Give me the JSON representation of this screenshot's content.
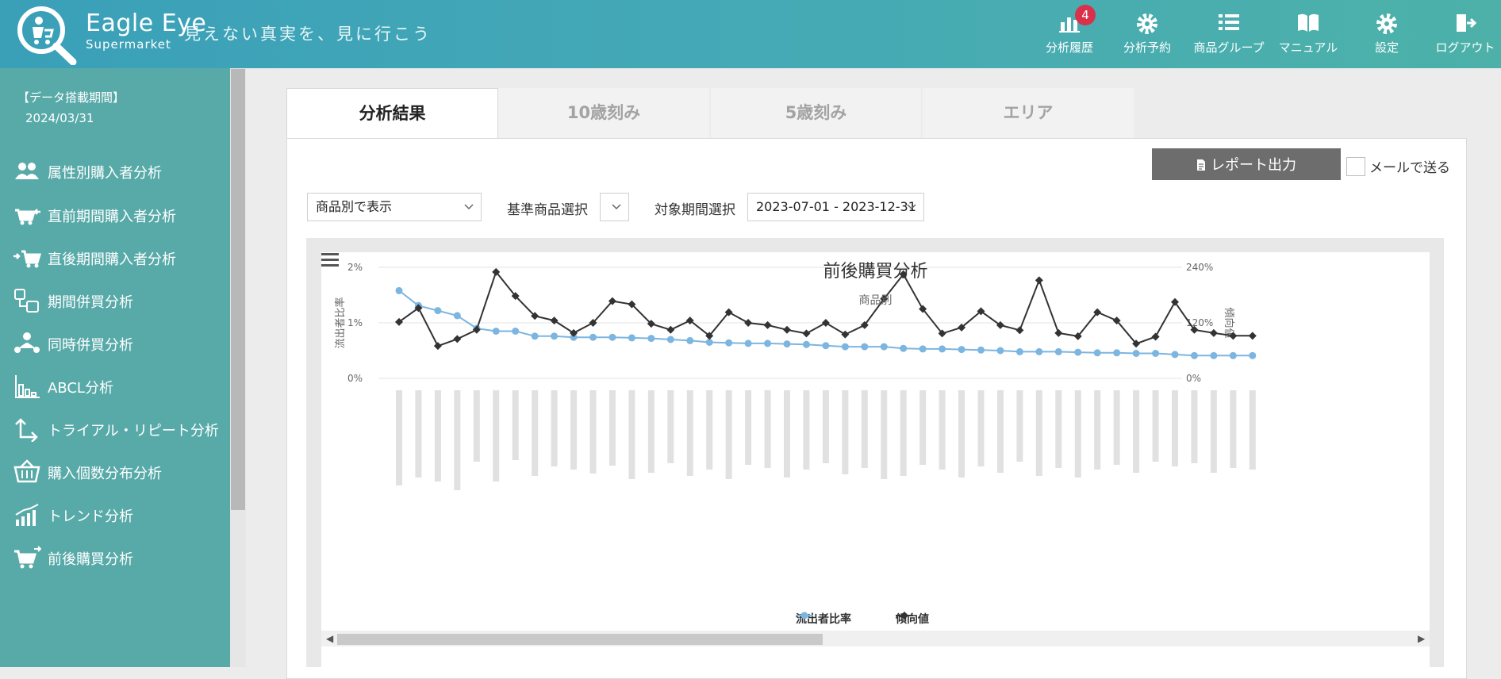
{
  "brand": {
    "name": "Eagle Eye",
    "sub": "Supermarket",
    "tagline": "見えない真実を、見に行こう"
  },
  "nav": [
    {
      "label": "分析履歴",
      "icon": "bar-chart-icon",
      "badge": "4"
    },
    {
      "label": "分析予約",
      "icon": "gear-badge-icon"
    },
    {
      "label": "商品グループ",
      "icon": "list-icon"
    },
    {
      "label": "マニュアル",
      "icon": "book-icon"
    },
    {
      "label": "設定",
      "icon": "gear-icon"
    },
    {
      "label": "ログアウト",
      "icon": "logout-icon"
    }
  ],
  "sidebar": {
    "period_label": "【データ搭載期間】",
    "period_date": "2024/03/31",
    "items": [
      {
        "label": "属性別購入者分析",
        "icon": "people-icon"
      },
      {
        "label": "直前期間購入者分析",
        "icon": "cart-back-icon"
      },
      {
        "label": "直後期間購入者分析",
        "icon": "cart-forward-icon"
      },
      {
        "label": "期間併買分析",
        "icon": "calendar-link-icon"
      },
      {
        "label": "同時併買分析",
        "icon": "person-network-icon"
      },
      {
        "label": "ABCL分析",
        "icon": "abcl-chart-icon"
      },
      {
        "label": "トライアル・リピート分析",
        "icon": "trial-repeat-icon"
      },
      {
        "label": "購入個数分布分析",
        "icon": "basket-icon"
      },
      {
        "label": "トレンド分析",
        "icon": "trend-icon"
      },
      {
        "label": "前後購買分析",
        "icon": "cart-swap-icon"
      }
    ]
  },
  "tabs": [
    {
      "label": "分析結果",
      "active": true
    },
    {
      "label": "10歳刻み",
      "active": false
    },
    {
      "label": "5歳刻み",
      "active": false
    },
    {
      "label": "エリア",
      "active": false
    }
  ],
  "toolbar": {
    "report_label": "レポート出力",
    "mail_label": "メールで送る"
  },
  "filters": {
    "display_value": "商品別で表示",
    "base_label": "基準商品選択",
    "base_value": "",
    "period_label": "対象期間選択",
    "period_value": "2023-07-01 - 2023-12-31"
  },
  "chart_data": {
    "type": "line",
    "title": "前後購買分析",
    "subtitle": "商品別",
    "ylabel": "流出者比率",
    "y2label": "傾向値",
    "ylim": [
      0,
      2
    ],
    "y2lim": [
      0,
      240
    ],
    "yticks": [
      "0%",
      "1%",
      "2%"
    ],
    "y2ticks": [
      "0%",
      "120%",
      "240%"
    ],
    "grid": true,
    "legend_placement": "bottom",
    "categories_count": 45,
    "series": [
      {
        "name": "流出者比率",
        "axis": "left",
        "color": "#7cb5e0",
        "values": [
          1.58,
          1.31,
          1.22,
          1.13,
          0.9,
          0.85,
          0.85,
          0.76,
          0.76,
          0.74,
          0.74,
          0.74,
          0.73,
          0.72,
          0.7,
          0.68,
          0.65,
          0.64,
          0.63,
          0.63,
          0.62,
          0.61,
          0.59,
          0.57,
          0.57,
          0.57,
          0.54,
          0.53,
          0.53,
          0.52,
          0.51,
          0.5,
          0.48,
          0.48,
          0.48,
          0.47,
          0.46,
          0.46,
          0.45,
          0.45,
          0.43,
          0.41,
          0.41,
          0.41,
          0.41
        ]
      },
      {
        "name": "傾向値",
        "axis": "right",
        "color": "#333333",
        "values": [
          122,
          152,
          70,
          85,
          105,
          230,
          178,
          135,
          125,
          98,
          120,
          167,
          160,
          118,
          105,
          125,
          92,
          143,
          120,
          115,
          105,
          97,
          120,
          95,
          115,
          172,
          225,
          150,
          97,
          110,
          145,
          115,
          104,
          212,
          98,
          91,
          143,
          125,
          75,
          90,
          165,
          105,
          98,
          92,
          92
        ]
      }
    ]
  }
}
